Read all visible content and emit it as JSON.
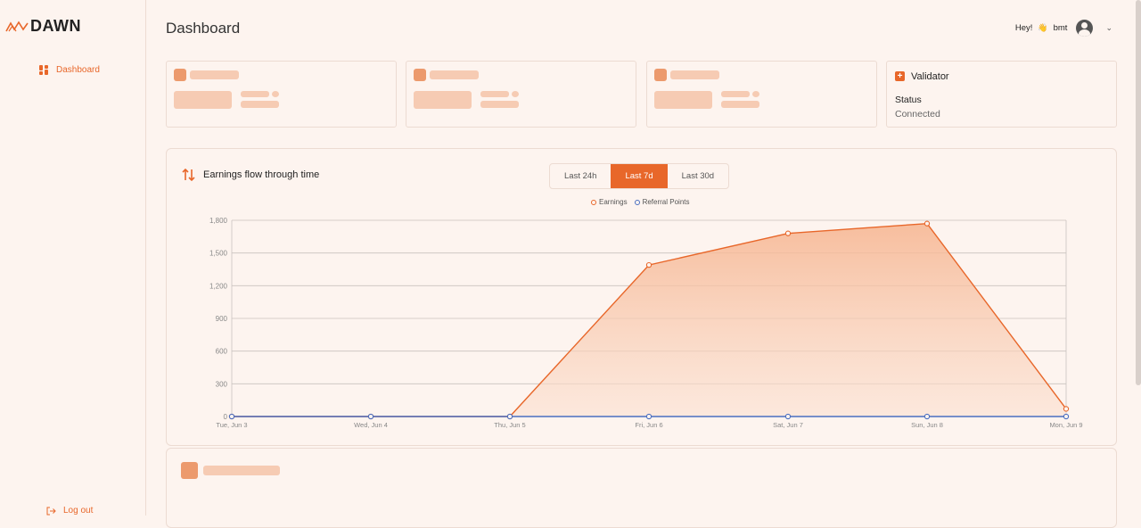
{
  "brand": {
    "name": "DAWN",
    "accent": "#e8672a"
  },
  "sidebar": {
    "items": [
      {
        "label": "Dashboard",
        "icon": "dashboard-icon",
        "active": true
      }
    ],
    "logout_label": "Log out"
  },
  "header": {
    "title": "Dashboard",
    "greeting": "Hey!",
    "wave_emoji": "👋",
    "username": "bmt"
  },
  "validator_card": {
    "title": "Validator",
    "status_label": "Status",
    "status_value": "Connected"
  },
  "chart_panel": {
    "title": "Earnings flow through time",
    "ranges": [
      "Last 24h",
      "Last 7d",
      "Last 30d"
    ],
    "active_range": "Last 7d"
  },
  "chart_data": {
    "type": "area",
    "x": [
      "Tue, Jun 3",
      "Wed, Jun 4",
      "Thu, Jun 5",
      "Fri, Jun 6",
      "Sat, Jun 7",
      "Sun, Jun 8",
      "Mon, Jun 9"
    ],
    "series": [
      {
        "name": "Earnings",
        "color": "#e8672a",
        "values": [
          0,
          0,
          0,
          1390,
          1680,
          1770,
          70
        ]
      },
      {
        "name": "Referral Points",
        "color": "#4a6fc1",
        "values": [
          0,
          0,
          0,
          0,
          0,
          0,
          0
        ]
      }
    ],
    "yticks": [
      "0",
      "300",
      "600",
      "900",
      "1,200",
      "1,500",
      "1,800"
    ],
    "ylim": [
      0,
      1800
    ],
    "grid": true,
    "legend_position": "top-center"
  }
}
